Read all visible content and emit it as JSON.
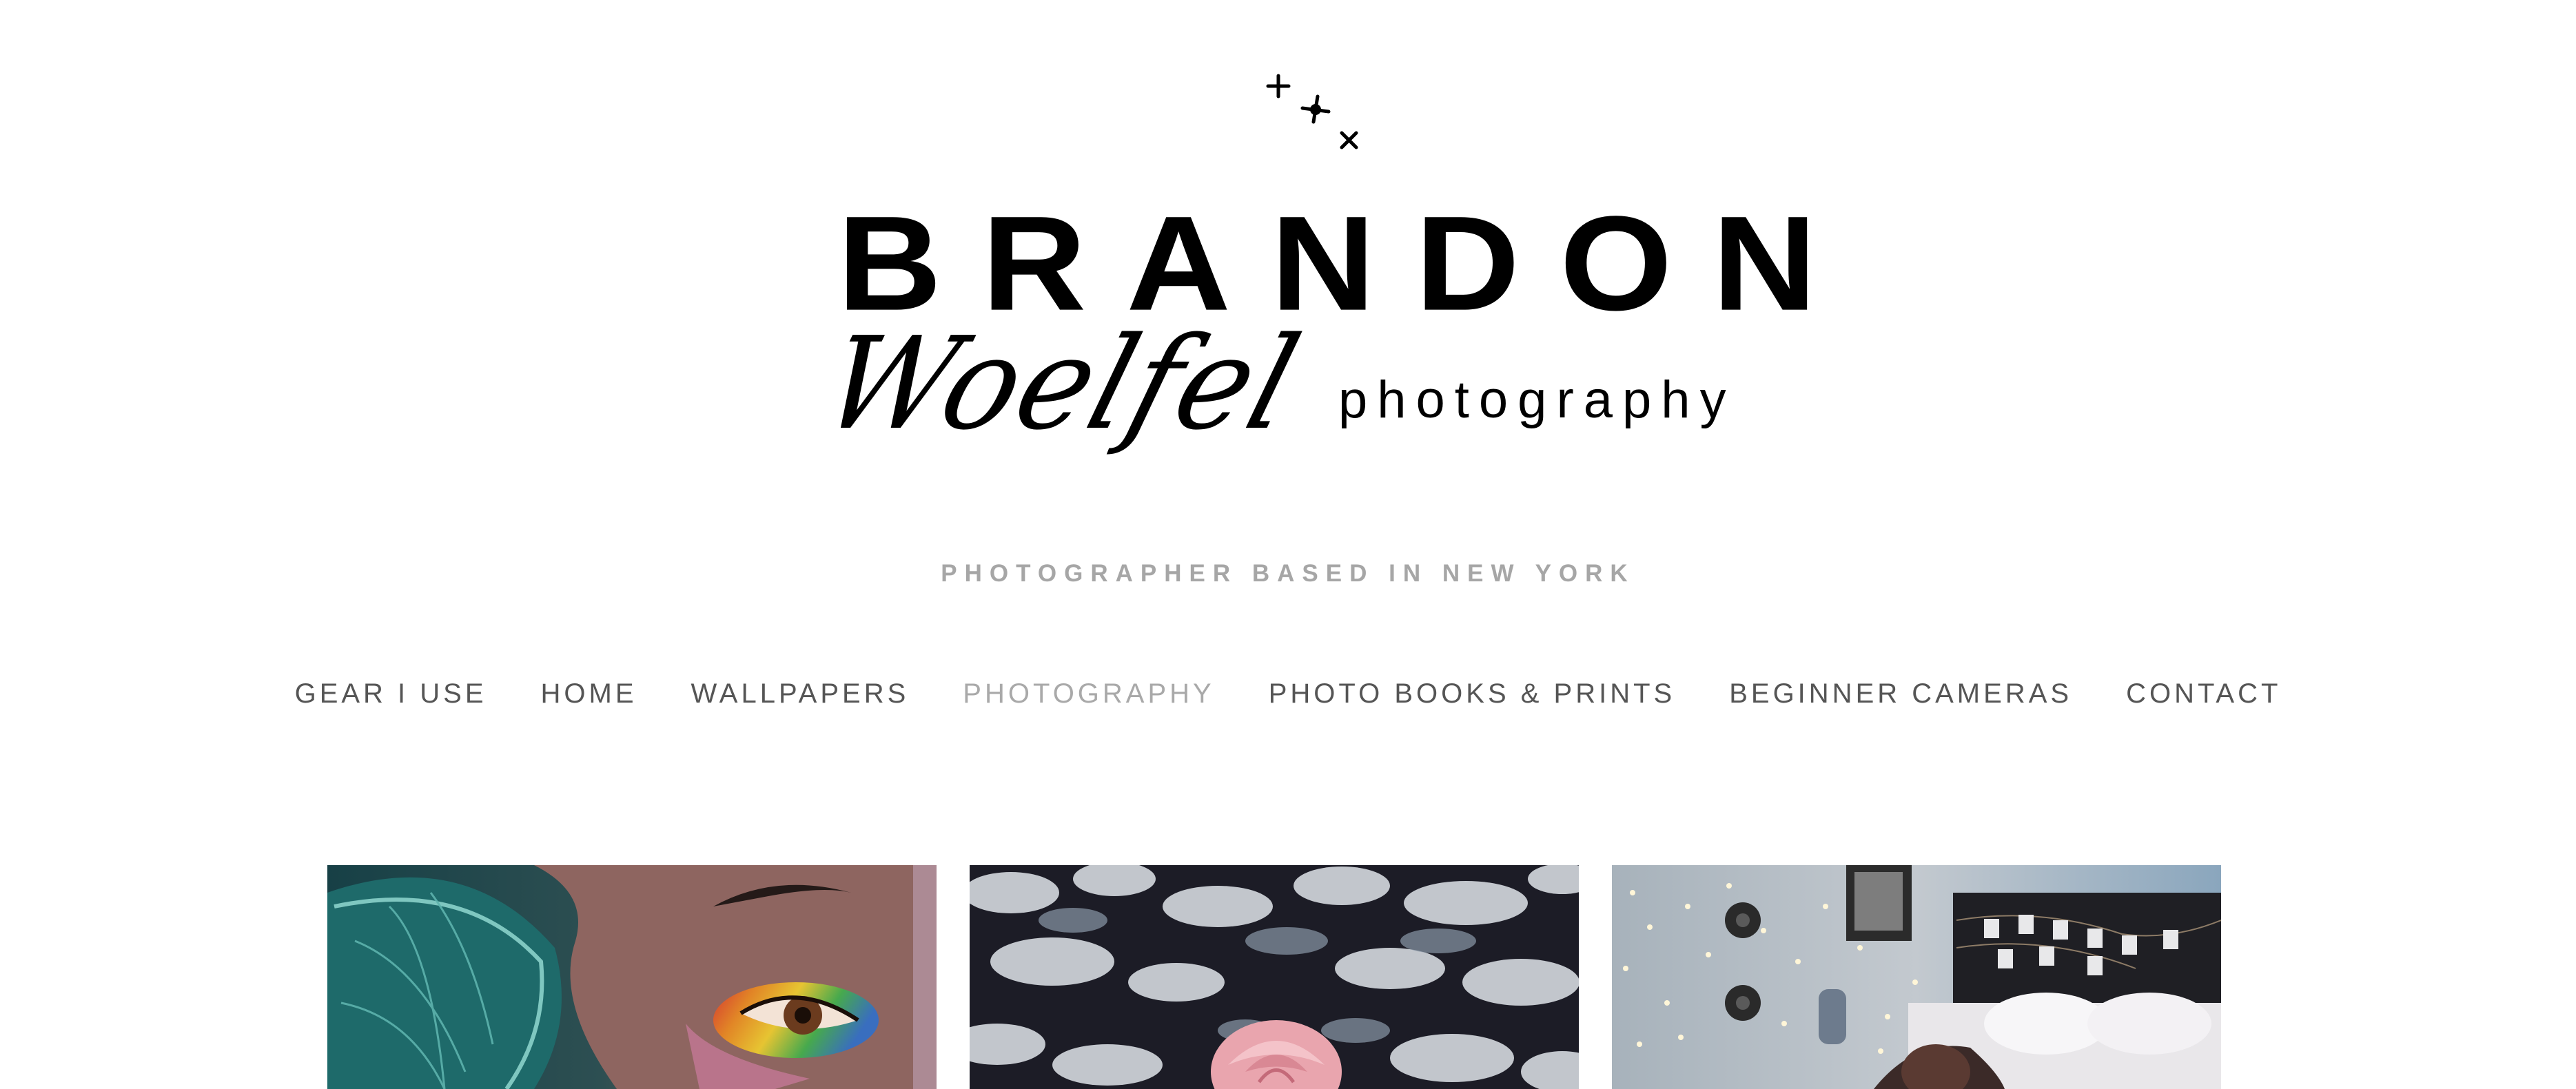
{
  "logo": {
    "line1": "BRANDON",
    "script": "Woelfel",
    "suffix": "photography",
    "sparkle_icon": "sparkle-icon"
  },
  "tagline": "PHOTOGRAPHER BASED IN NEW YORK",
  "nav": {
    "active": "PHOTOGRAPHY",
    "items": [
      "GEAR I USE",
      "HOME",
      "WALLPAPERS",
      "PHOTOGRAPHY",
      "PHOTO BOOKS & PRINTS",
      "BEGINNER CAMERAS",
      "CONTACT"
    ]
  },
  "gallery": {
    "images": [
      {
        "name": "rainbow-eye-portrait",
        "subject": "face with rainbow light"
      },
      {
        "name": "snowy-rose",
        "subject": "pink rose in snow"
      },
      {
        "name": "bedroom-fairy-lights",
        "subject": "bedroom with string lights"
      }
    ]
  },
  "colors": {
    "background": "#ffffff",
    "logo": "#000000",
    "nav_text": "#555555",
    "nav_active": "#a9a9a9",
    "tagline": "#a6a6a6"
  }
}
